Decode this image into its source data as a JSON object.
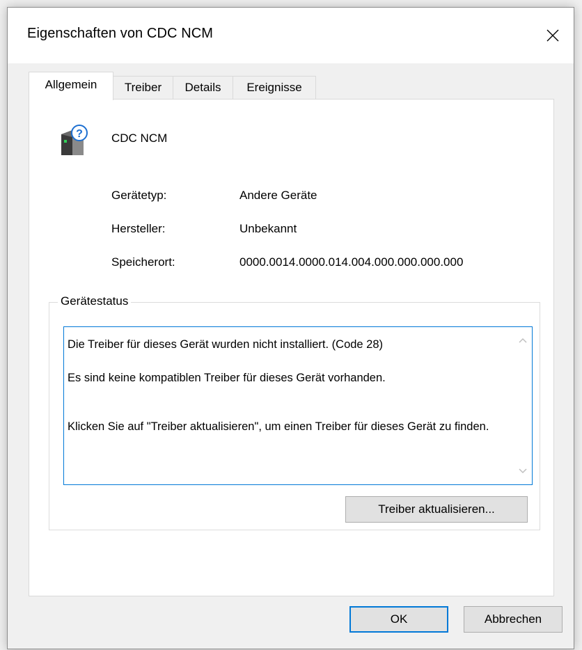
{
  "window": {
    "title": "Eigenschaften von CDC NCM"
  },
  "tabs": [
    {
      "label": "Allgemein",
      "active": true
    },
    {
      "label": "Treiber",
      "active": false
    },
    {
      "label": "Details",
      "active": false
    },
    {
      "label": "Ereignisse",
      "active": false
    }
  ],
  "device": {
    "icon": "unknown-device-icon",
    "name": "CDC NCM"
  },
  "properties": [
    {
      "label": "Gerätetyp:",
      "value": "Andere Geräte"
    },
    {
      "label": "Hersteller:",
      "value": "Unbekannt"
    },
    {
      "label": "Speicherort:",
      "value": "0000.0014.0000.014.004.000.000.000.000"
    }
  ],
  "device_status": {
    "legend": "Gerätestatus",
    "lines": [
      "Die Treiber für dieses Gerät wurden nicht installiert. (Code 28)",
      "Es sind keine kompatiblen Treiber für dieses Gerät vorhanden.",
      "Klicken Sie auf \"Treiber aktualisieren\", um einen Treiber für dieses Gerät zu finden."
    ],
    "update_button": "Treiber aktualisieren..."
  },
  "footer": {
    "ok_label": "OK",
    "cancel_label": "Abbrechen"
  },
  "colors": {
    "accent": "#0078d7",
    "window_bg": "#f0f0f0",
    "button_bg": "#e1e1e1"
  }
}
